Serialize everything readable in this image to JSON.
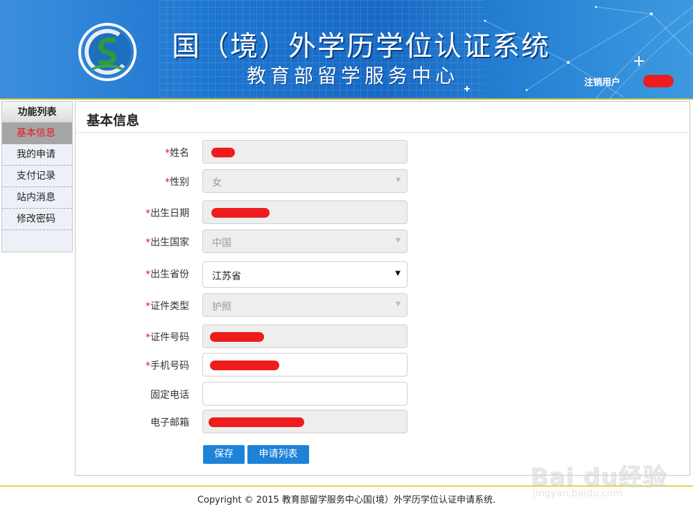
{
  "header": {
    "title": "国（境）外学历学位认证系统",
    "subtitle": "教育部留学服务中心",
    "logout_label": "注销用户"
  },
  "sidebar": {
    "title": "功能列表",
    "items": [
      {
        "label": "基本信息",
        "active": true
      },
      {
        "label": "我的申请",
        "active": false
      },
      {
        "label": "支付记录",
        "active": false
      },
      {
        "label": "站内消息",
        "active": false
      },
      {
        "label": "修改密码",
        "active": false
      }
    ]
  },
  "main": {
    "title": "基本信息",
    "fields": {
      "name": {
        "label": "姓名",
        "required": true,
        "value": ""
      },
      "gender": {
        "label": "性别",
        "required": true,
        "value": "女"
      },
      "birth_date": {
        "label": "出生日期",
        "required": true,
        "value": ""
      },
      "birth_country": {
        "label": "出生国家",
        "required": true,
        "value": "中国"
      },
      "birth_province": {
        "label": "出生省份",
        "required": true,
        "value": "江苏省"
      },
      "id_type": {
        "label": "证件类型",
        "required": true,
        "value": "护照"
      },
      "id_number": {
        "label": "证件号码",
        "required": true,
        "value": ""
      },
      "mobile": {
        "label": "手机号码",
        "required": true,
        "value": ""
      },
      "landline": {
        "label": "固定电话",
        "required": false,
        "value": ""
      },
      "email": {
        "label": "电子邮箱",
        "required": false,
        "value": ""
      }
    },
    "required_mark": "*",
    "buttons": {
      "save": "保存",
      "application_list": "申请列表"
    }
  },
  "footer": {
    "copyright": "Copyright © 2015 教育部留学服务中心国(境）外学历学位认证申请系统."
  },
  "watermark": {
    "brand": "Bai du经验",
    "url": "jingyan.baidu.com"
  },
  "colors": {
    "header_blue": "#1769c4",
    "accent_button": "#1e82d8",
    "required_red": "#e8141b",
    "divider_gold": "#d9c74f"
  }
}
